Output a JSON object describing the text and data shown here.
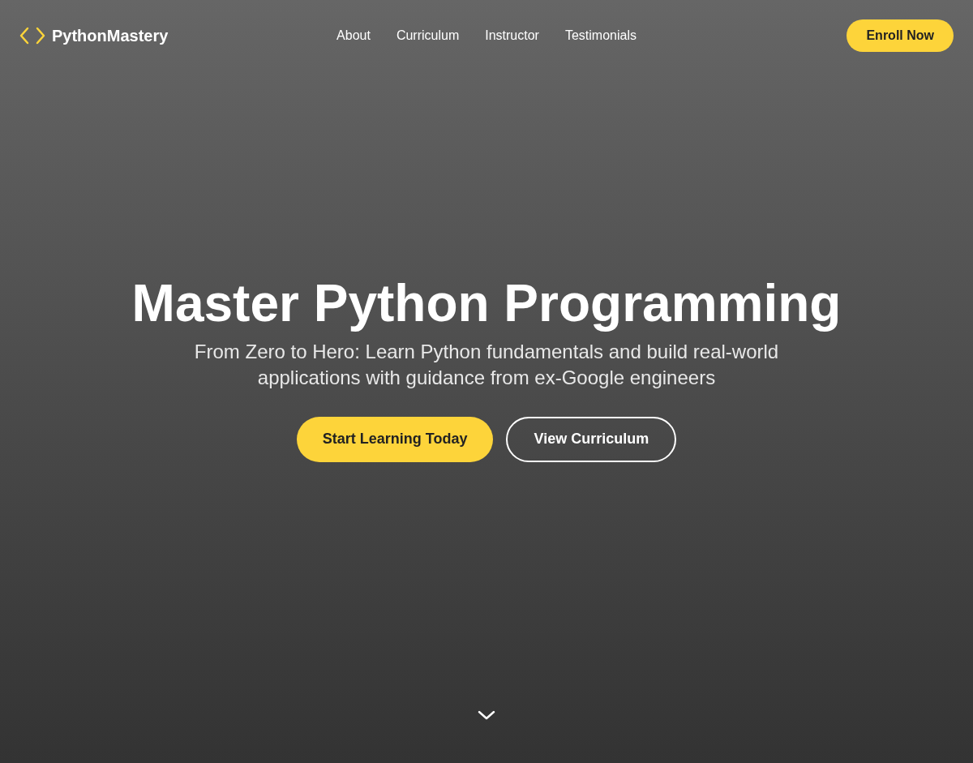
{
  "header": {
    "logo_text": "PythonMastery",
    "nav_links": [
      "About",
      "Curriculum",
      "Instructor",
      "Testimonials"
    ],
    "cta": "Enroll Now"
  },
  "hero": {
    "title": "Master Python Programming",
    "subtitle": "From Zero to Hero: Learn Python fundamentals and build real-world applications with guidance from ex-Google engineers",
    "buttons": [
      {
        "label": "Start Learning Today",
        "kind": "primary"
      },
      {
        "label": "View Curriculum",
        "kind": "outline"
      }
    ]
  }
}
